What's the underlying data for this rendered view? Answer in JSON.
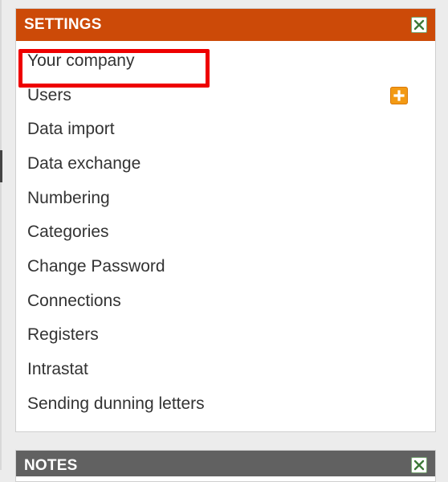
{
  "settings_panel": {
    "title": "SETTINGS",
    "header_color": "#cc4a08",
    "close_icon": "close-icon",
    "items": [
      {
        "label": "Your company",
        "highlighted": true
      },
      {
        "label": "Users",
        "action_icon": "add-icon"
      },
      {
        "label": "Data import"
      },
      {
        "label": "Data exchange"
      },
      {
        "label": "Numbering"
      },
      {
        "label": "Categories"
      },
      {
        "label": "Change Password"
      },
      {
        "label": "Connections"
      },
      {
        "label": "Registers"
      },
      {
        "label": "Intrastat"
      },
      {
        "label": "Sending dunning letters"
      }
    ]
  },
  "notes_panel": {
    "title": "NOTES",
    "header_color": "#616161",
    "close_icon": "close-icon"
  },
  "highlight_color": "#ee0000",
  "add_icon_color": "#f39a14"
}
